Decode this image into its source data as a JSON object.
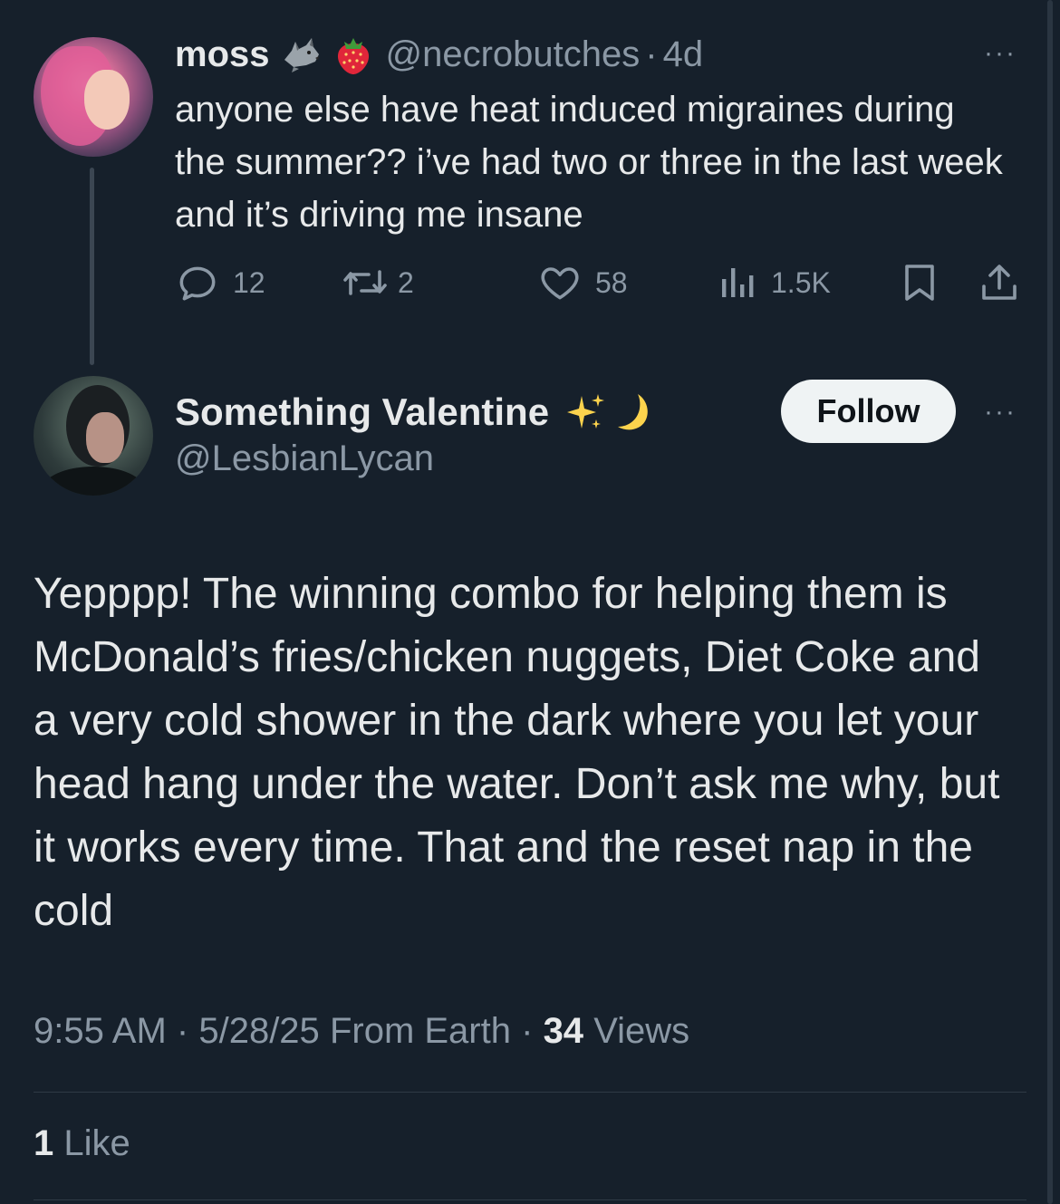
{
  "parent_tweet": {
    "display_name": "moss",
    "name_emojis": [
      "wolf-emoji",
      "strawberry-emoji"
    ],
    "handle": "@necrobutches",
    "separator": "·",
    "time_ago": "4d",
    "more": "···",
    "text": "anyone else have heat induced migraines during the summer?? i’ve had two or three in the last week and it’s driving me insane",
    "actions": {
      "replies": "12",
      "reposts": "2",
      "likes": "58",
      "views": "1.5K"
    }
  },
  "reply_tweet": {
    "display_name": "Something Valentine",
    "name_emojis": [
      "sparkles-emoji",
      "crescent-moon-emoji"
    ],
    "handle": "@LesbianLycan",
    "follow_label": "Follow",
    "more": "···",
    "text": "Yepppp! The winning combo for helping them is McDonald’s fries/chicken nuggets, Diet Coke and a very cold shower in the dark where you let your head hang under the water. Don’t ask me why, but it works every time. That and the reset nap in the cold",
    "meta": {
      "time": "9:55 AM",
      "separator": "·",
      "date": "5/28/25",
      "source": "From Earth",
      "views_count": "34",
      "views_label": "Views"
    },
    "likes": {
      "count": "1",
      "label": "Like"
    }
  },
  "colors": {
    "background": "#16202b",
    "text_primary": "#e7e9ea",
    "text_secondary": "#8b98a5",
    "follow_button_bg": "#eff3f4"
  }
}
